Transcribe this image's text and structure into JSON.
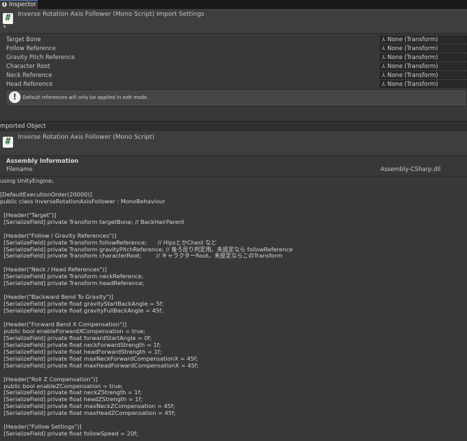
{
  "tab": {
    "label": "Inspector"
  },
  "header": {
    "icon_glyph": "#",
    "title": "Inverse Rotation Axis Follower (Mono Script) Import Settings"
  },
  "fields": [
    {
      "label": "Target Bone",
      "value": "None (Transform)"
    },
    {
      "label": "Follow Reference",
      "value": "None (Transform)"
    },
    {
      "label": "Gravity Pitch Reference",
      "value": "None (Transform)"
    },
    {
      "label": "Character Root",
      "value": "None (Transform)"
    },
    {
      "label": "Neck Reference",
      "value": "None (Transform)"
    },
    {
      "label": "Head Reference",
      "value": "None (Transform)"
    }
  ],
  "help": {
    "icon_glyph": "!",
    "text": "Default references will only be applied in edit mode."
  },
  "imported": {
    "label": "mported Object",
    "title": "Inverse Rotation Axis Follower (Mono Script)",
    "icon_glyph": "#"
  },
  "assembly": {
    "title": "Assembly Information",
    "filename_label": "Filename",
    "filename_value": "Assembly-CSharp.dll"
  },
  "code_lines": [
    "using UnityEngine;",
    "",
    "[DefaultExecutionOrder(20000)]",
    "public class InverseRotationAxisFollower : MonoBehaviour",
    "",
    "  [Header(\"Target\")]",
    "  [SerializeField] private Transform targetBone; // BackHairParent",
    "",
    "  [Header(\"Follow / Gravity References\")]",
    "  [SerializeField] private Transform followReference;      // HipsとかChest など",
    "  [SerializeField] private Transform gravityPitchReference; // 後ろ反り判定用。未設定なら followReference",
    "  [SerializeField] private Transform characterRoot;        // キャラクターRoot。未設定ならこのTransform",
    "",
    "  [Header(\"Neck / Head References\")]",
    "  [SerializeField] private Transform neckReference;",
    "  [SerializeField] private Transform headReference;",
    "",
    "  [Header(\"Backward Bend To Gravity\")]",
    "  [SerializeField] private float gravityStartBackAngle = 5f;",
    "  [SerializeField] private float gravityFullBackAngle = 45f;",
    "",
    "  [Header(\"Forward Bend X Compensation\")]",
    "  public bool enableForwardXCompensation = true;",
    "  [SerializeField] private float forwardStartAngle = 0f;",
    "  [SerializeField] private float neckForwardStrength = 1f;",
    "  [SerializeField] private float headForwardStrength = 1f;",
    "  [SerializeField] private float maxNeckForwardCompensationX = 45f;",
    "  [SerializeField] private float maxHeadForwardCompensationX = 45f;",
    "",
    "  [Header(\"Roll Z Compensation\")]",
    "  public bool enableZCompensation = true;",
    "  [SerializeField] private float neckZStrength = 1f;",
    "  [SerializeField] private float headZStrength = 1f;",
    "  [SerializeField] private float maxNeckZCompensation = 45f;",
    "  [SerializeField] private float maxHeadZCompensation = 45f;",
    "",
    "  [Header(\"Follow Settings\")]",
    "  [SerializeField] private float followSpeed = 20f;"
  ]
}
